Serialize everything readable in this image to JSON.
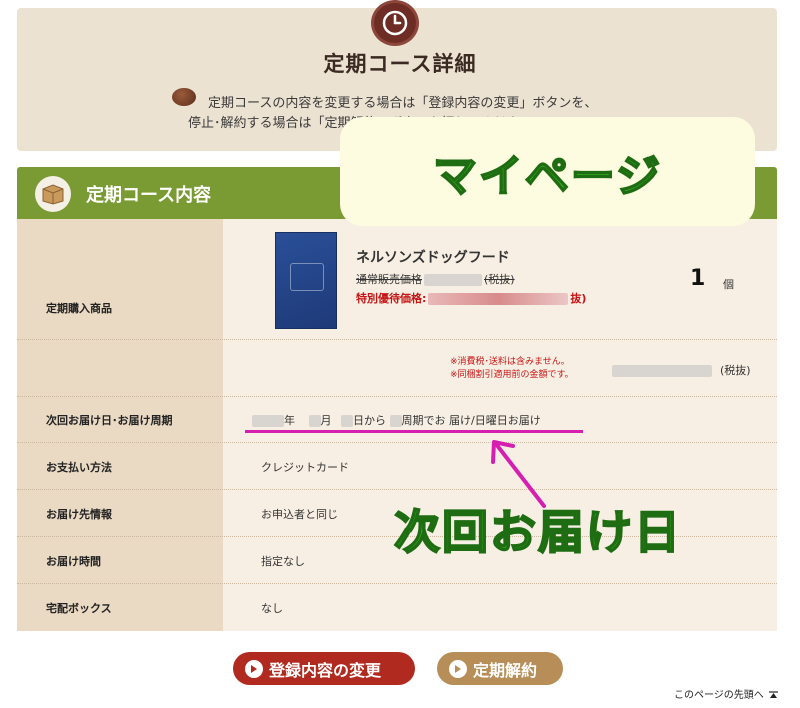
{
  "header": {
    "icon": "clock-icon",
    "title": "定期コース詳細",
    "desc_line1": "定期コースの内容を変更する場合は「登録内容の変更」ボタンを、",
    "desc_line2": "停止･解約する場合は「定期解約」ボタンを押してください"
  },
  "section": {
    "icon": "box-icon",
    "title": "定期コース内容"
  },
  "rows": {
    "product_label": "定期購入商品",
    "product_name": "ネルソンズドッグフード",
    "normal_price_label": "通常販売価格",
    "normal_price_suffix": "(税抜)",
    "special_price_label": "特別優待価格:",
    "special_price_suffix": "抜)",
    "quantity": "1",
    "quantity_unit": "個",
    "note1": "※消費税･送料は含みません。",
    "note2": "※同梱割引適用前の金額です。",
    "total_suffix": "(税抜)",
    "next_delivery_label": "次回お届け日･お届け周期",
    "next_delivery_parts": [
      "年",
      "月",
      "日から",
      "周期でお 届け/",
      "日曜日お届け"
    ],
    "payment_label": "お支払い方法",
    "payment_value": "クレジットカード",
    "destination_label": "お届け先情報",
    "destination_value": "お申込者と同じ",
    "time_label": "お届け時間",
    "time_value": "指定なし",
    "box_label": "宅配ボックス",
    "box_value": "なし"
  },
  "buttons": {
    "change": "登録内容の変更",
    "cancel": "定期解約"
  },
  "overlay": {
    "mypage": "マイページ",
    "next_delivery": "次回お届け日"
  },
  "footer": {
    "to_top": "このページの先頭へ"
  },
  "colors": {
    "section_green": "#7a9a34",
    "highlight_magenta": "#d61fb0",
    "overlay_green": "#3ec426",
    "change_button": "#b02a1f",
    "cancel_button": "#b78e57"
  }
}
